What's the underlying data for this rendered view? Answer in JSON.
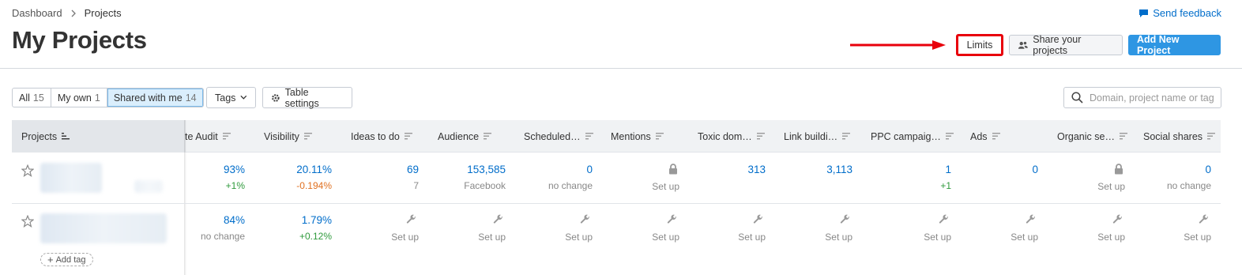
{
  "breadcrumb": {
    "items": [
      "Dashboard",
      "Projects"
    ]
  },
  "page": {
    "title": "My Projects"
  },
  "header": {
    "feedback_label": "Send feedback",
    "limits_label": "Limits",
    "share_label": "Share your projects",
    "add_label": "Add New Project"
  },
  "filters": {
    "all_label": "All",
    "all_count": "15",
    "own_label": "My own",
    "own_count": "1",
    "shared_label": "Shared with me",
    "shared_count": "14",
    "tags_label": "Tags",
    "table_settings_label": "Table settings"
  },
  "search": {
    "placeholder": "Domain, project name or tag"
  },
  "table": {
    "columns": [
      "Projects",
      "te Audit",
      "Visibility",
      "Ideas to do",
      "Audience",
      "Scheduled…",
      "Mentions",
      "Toxic dom…",
      "Link buildi…",
      "PPC campaig…",
      "Ads",
      "Organic se…",
      "Social shares"
    ],
    "rows": [
      {
        "audit": {
          "value": "93%",
          "sub": "+1%"
        },
        "visibility": {
          "value": "20.11%",
          "sub": "-0.194%"
        },
        "ideas": {
          "value": "69",
          "sub": "7"
        },
        "audience": {
          "value": "153,585",
          "sub": "Facebook"
        },
        "scheduled": {
          "value": "0",
          "sub": "no change"
        },
        "mentions": {
          "sub": "Set up"
        },
        "toxic": {
          "value": "313"
        },
        "link": {
          "value": "3,113"
        },
        "ppc": {
          "value": "1",
          "sub": "+1"
        },
        "ads": {
          "value": "0"
        },
        "organic": {
          "sub": "Set up"
        },
        "social": {
          "value": "0",
          "sub": "no change"
        }
      },
      {
        "audit": {
          "value": "84%",
          "sub": "no change"
        },
        "visibility": {
          "value": "1.79%",
          "sub": "+0.12%"
        },
        "setup_label": "Set up",
        "add_tag_label": "Add tag"
      }
    ]
  },
  "colors": {
    "accent": "#2e96e3",
    "link": "#006dca",
    "highlight_box": "#e8000b",
    "positive": "#2f9a3c",
    "negative": "#e07020"
  }
}
